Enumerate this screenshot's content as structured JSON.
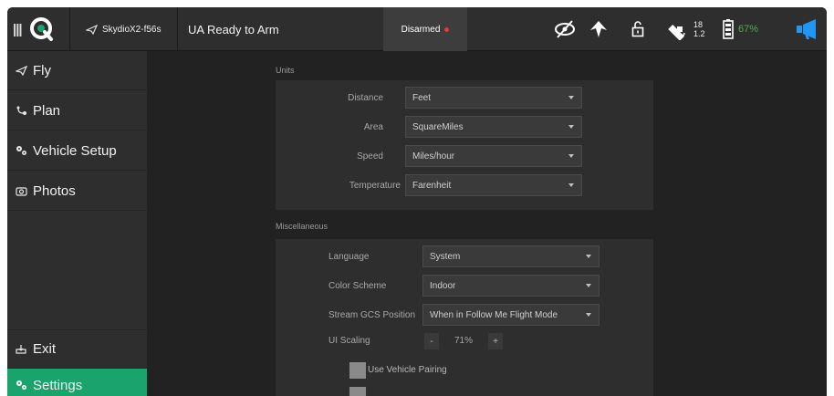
{
  "topbar": {
    "vehicle_name": "SkydioX2-f56s",
    "status": "UA Ready to Arm",
    "armed_status": "Disarmed",
    "gps_count": "18",
    "gps_hdop": "1.2",
    "battery_pct": "67%",
    "icons": [
      "menu-icon",
      "qgc-logo",
      "paper-plane-icon",
      "eye-off-icon",
      "propeller-icon",
      "unlock-icon",
      "gps-satellite-icon",
      "battery-icon",
      "megaphone-icon"
    ]
  },
  "sidebar": {
    "items": [
      {
        "label": "Fly"
      },
      {
        "label": "Plan"
      },
      {
        "label": "Vehicle Setup"
      },
      {
        "label": "Photos"
      },
      {
        "label": "Exit"
      },
      {
        "label": "Settings"
      }
    ]
  },
  "units": {
    "title": "Units",
    "rows": [
      {
        "label": "Distance",
        "value": "Feet"
      },
      {
        "label": "Area",
        "value": "SquareMiles"
      },
      {
        "label": "Speed",
        "value": "Miles/hour"
      },
      {
        "label": "Temperature",
        "value": "Farenheit"
      }
    ]
  },
  "misc": {
    "title": "Miscellaneous",
    "language_label": "Language",
    "language_value": "System",
    "color_scheme_label": "Color Scheme",
    "color_scheme_value": "Indoor",
    "stream_label": "Stream GCS Position",
    "stream_value": "When in Follow Me Flight Mode",
    "ui_scaling_label": "UI Scaling",
    "ui_scaling_minus": "-",
    "ui_scaling_value": "71%",
    "ui_scaling_plus": "+",
    "vehicle_pairing_label": "Use Vehicle Pairing"
  },
  "colors": {
    "accent": "#1aa36b",
    "background": "#222222",
    "panel": "#2e2e2e",
    "battery": "#4caf50",
    "megaphone": "#2196f3",
    "armed_dot": "#e53935"
  }
}
